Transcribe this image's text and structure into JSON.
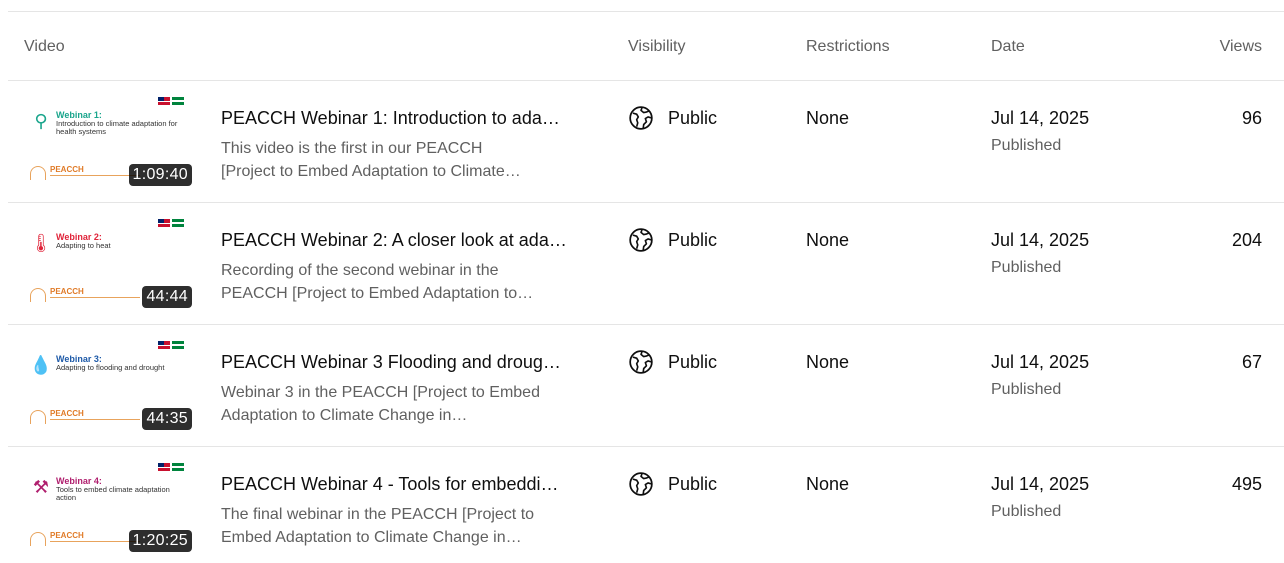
{
  "headers": {
    "video": "Video",
    "visibility": "Visibility",
    "restrictions": "Restrictions",
    "date": "Date",
    "views": "Views"
  },
  "rows": [
    {
      "thumb_title": "Webinar 1:",
      "thumb_subtitle": "Introduction to climate adaptation for health systems",
      "thumb_brand": "PEACCH",
      "thumb_color": "#1aa58c",
      "thumb_icon": "magnifier-icon",
      "duration": "1:09:40",
      "title": "PEACCH Webinar 1: Introduction to ada…",
      "desc_line1": "This video is the first in our PEACCH",
      "desc_line2": "[Project to Embed Adaptation to Climate…",
      "visibility": "Public",
      "restrictions": "None",
      "date": "Jul 14, 2025",
      "status": "Published",
      "views": "96"
    },
    {
      "thumb_title": "Webinar 2:",
      "thumb_subtitle": "Adapting to heat",
      "thumb_brand": "PEACCH",
      "thumb_color": "#e0243a",
      "thumb_icon": "thermometer-icon",
      "duration": "44:44",
      "title": "PEACCH Webinar 2: A closer look at ada…",
      "desc_line1": "Recording of the second webinar in the",
      "desc_line2": "PEACCH [Project to Embed Adaptation to…",
      "visibility": "Public",
      "restrictions": "None",
      "date": "Jul 14, 2025",
      "status": "Published",
      "views": "204"
    },
    {
      "thumb_title": "Webinar 3:",
      "thumb_subtitle": "Adapting to flooding and drought",
      "thumb_brand": "PEACCH",
      "thumb_color": "#1e5aa8",
      "thumb_icon": "water-drop-icon",
      "duration": "44:35",
      "title": "PEACCH Webinar 3 Flooding and droug…",
      "desc_line1": "Webinar 3 in the PEACCH [Project to Embed",
      "desc_line2": "Adaptation to Climate Change in…",
      "visibility": "Public",
      "restrictions": "None",
      "date": "Jul 14, 2025",
      "status": "Published",
      "views": "67"
    },
    {
      "thumb_title": "Webinar 4:",
      "thumb_subtitle": "Tools to embed climate adaptation action",
      "thumb_brand": "PEACCH",
      "thumb_color": "#b01f6e",
      "thumb_icon": "toolbox-icon",
      "duration": "1:20:25",
      "title": "PEACCH Webinar 4 - Tools for embeddi…",
      "desc_line1": "The final webinar in the PEACCH [Project to",
      "desc_line2": "Embed Adaptation to Climate Change in…",
      "visibility": "Public",
      "restrictions": "None",
      "date": "Jul 14, 2025",
      "status": "Published",
      "views": "495"
    }
  ]
}
